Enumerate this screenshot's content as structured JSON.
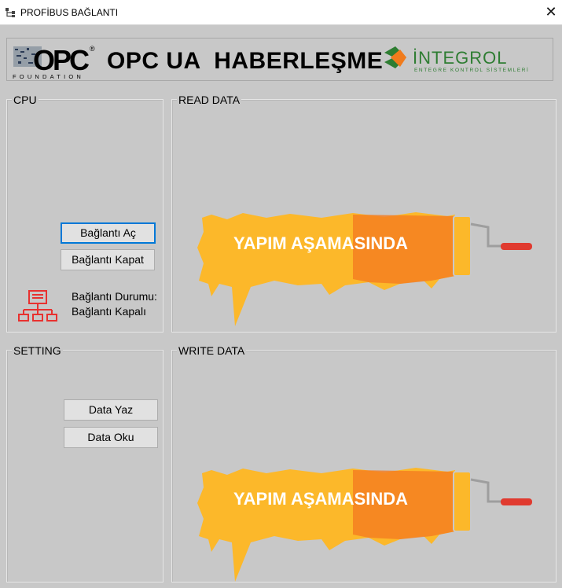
{
  "window": {
    "title": "PROFİBUS BAĞLANTI",
    "close_glyph": "✕",
    "app_icon": "network-tree-icon"
  },
  "header": {
    "title": "OPC UA  HABERLEŞME",
    "opc_logo": {
      "text": "OPC",
      "sub": "FOUNDATION",
      "reg": "®"
    },
    "integrol_logo": {
      "text": "İNTEGROL",
      "sub": "ENTEGRE KONTROL SİSTEMLERİ",
      "colors": {
        "orange": "#f07b1c",
        "green": "#2e7d32"
      }
    }
  },
  "cpu": {
    "legend": "CPU",
    "connect_label": "Bağlantı Aç",
    "disconnect_label": "Bağlantı Kapat",
    "status_label": "Bağlantı Durumu:",
    "status_value": "Bağlantı Kapalı",
    "status_icon": "network-status-icon",
    "status_color": "#e8312f"
  },
  "read": {
    "legend": "READ DATA",
    "banner_text": "YAPIM AŞAMASINDA"
  },
  "setting": {
    "legend": "SETTING",
    "write_label": "Data Yaz",
    "read_label": "Data Oku"
  },
  "write": {
    "legend": "WRITE DATA",
    "banner_text": "YAPIM AŞAMASINDA"
  },
  "colors": {
    "paint_yellow": "#fcb82a",
    "paint_orange": "#f47c20",
    "roller_red": "#e03a2f",
    "focus_blue": "#0078d7"
  }
}
